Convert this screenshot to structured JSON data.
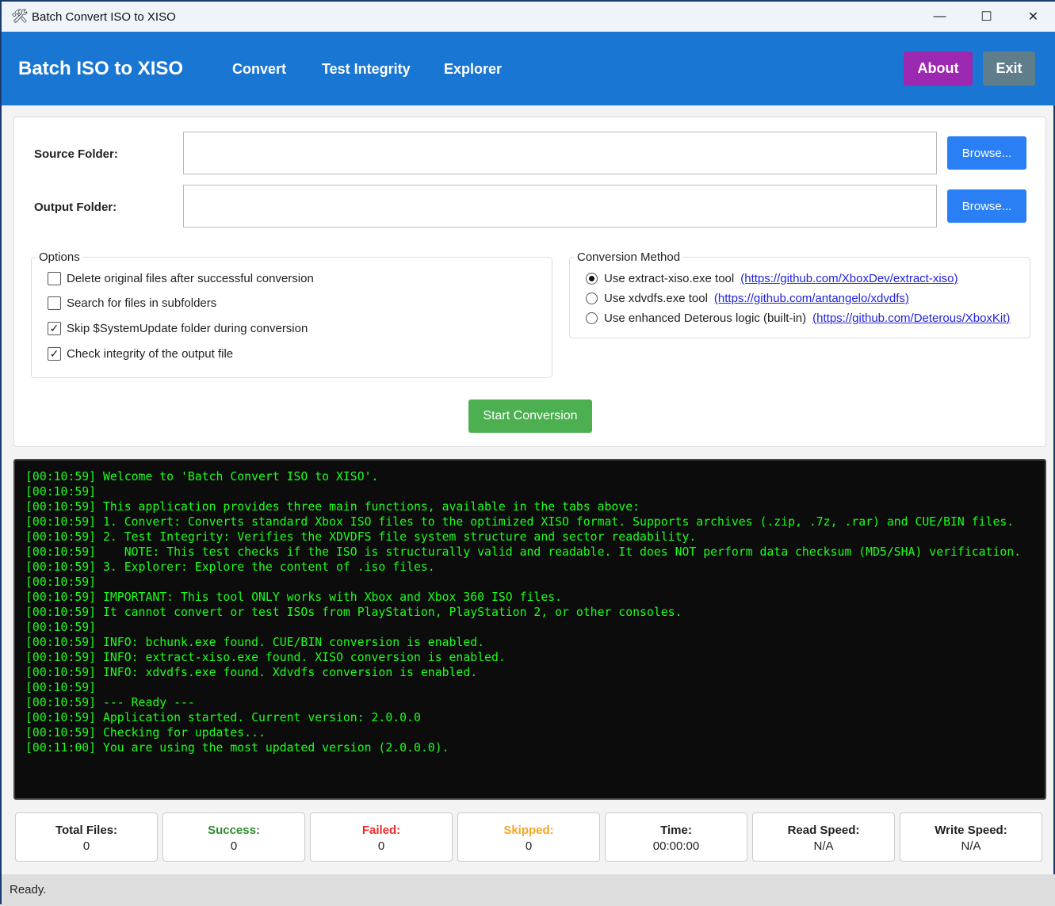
{
  "window": {
    "title": "Batch Convert ISO to XISO",
    "min": "—",
    "max": "☐",
    "close": "✕"
  },
  "header": {
    "brand": "Batch ISO to XISO",
    "tabs": [
      "Convert",
      "Test Integrity",
      "Explorer"
    ],
    "about": "About",
    "exit": "Exit",
    "colors": {
      "bar": "#1976d2",
      "about": "#9c27b0",
      "exit": "#607d8b"
    }
  },
  "form": {
    "source_label": "Source Folder:",
    "source_value": "",
    "output_label": "Output Folder:",
    "output_value": "",
    "browse": "Browse..."
  },
  "options": {
    "legend": "Options",
    "items": [
      {
        "label": "Delete original files after successful conversion",
        "checked": false
      },
      {
        "label": "Search for files in subfolders",
        "checked": false
      },
      {
        "label": "Skip $SystemUpdate folder during conversion",
        "checked": true
      },
      {
        "label": "Check integrity of the output file",
        "checked": true
      }
    ]
  },
  "method": {
    "legend": "Conversion Method",
    "items": [
      {
        "label": "Use extract-xiso.exe tool",
        "link": "(https://github.com/XboxDev/extract-xiso)",
        "selected": true
      },
      {
        "label": "Use xdvdfs.exe tool",
        "link": "(https://github.com/antangelo/xdvdfs)",
        "selected": false
      },
      {
        "label": "Use enhanced Deterous logic (built-in)",
        "link": "(https://github.com/Deterous/XboxKit)",
        "selected": false
      }
    ]
  },
  "start": "Start Conversion",
  "log": [
    "[00:10:59] Welcome to 'Batch Convert ISO to XISO'.",
    "[00:10:59]",
    "[00:10:59] This application provides three main functions, available in the tabs above:",
    "[00:10:59] 1. Convert: Converts standard Xbox ISO files to the optimized XISO format. Supports archives (.zip, .7z, .rar) and CUE/BIN files.",
    "[00:10:59] 2. Test Integrity: Verifies the XDVDFS file system structure and sector readability.",
    "[00:10:59]    NOTE: This test checks if the ISO is structurally valid and readable. It does NOT perform data checksum (MD5/SHA) verification.",
    "[00:10:59] 3. Explorer: Explore the content of .iso files.",
    "[00:10:59]",
    "[00:10:59] IMPORTANT: This tool ONLY works with Xbox and Xbox 360 ISO files.",
    "[00:10:59] It cannot convert or test ISOs from PlayStation, PlayStation 2, or other consoles.",
    "[00:10:59]",
    "[00:10:59] INFO: bchunk.exe found. CUE/BIN conversion is enabled.",
    "[00:10:59] INFO: extract-xiso.exe found. XISO conversion is enabled.",
    "[00:10:59] INFO: xdvdfs.exe found. Xdvdfs conversion is enabled.",
    "[00:10:59]",
    "[00:10:59] --- Ready ---",
    "[00:10:59] Application started. Current version: 2.0.0.0",
    "[00:10:59] Checking for updates...",
    "[00:11:00] You are using the most updated version (2.0.0.0)."
  ],
  "stats": [
    {
      "label": "Total Files:",
      "value": "0",
      "color": "#222222"
    },
    {
      "label": "Success:",
      "value": "0",
      "color": "#2e8b2e"
    },
    {
      "label": "Failed:",
      "value": "0",
      "color": "#f02828"
    },
    {
      "label": "Skipped:",
      "value": "0",
      "color": "#f5a623"
    },
    {
      "label": "Time:",
      "value": "00:00:00",
      "color": "#222222"
    },
    {
      "label": "Read Speed:",
      "value": "N/A",
      "color": "#222222"
    },
    {
      "label": "Write Speed:",
      "value": "N/A",
      "color": "#222222"
    }
  ],
  "status": "Ready."
}
